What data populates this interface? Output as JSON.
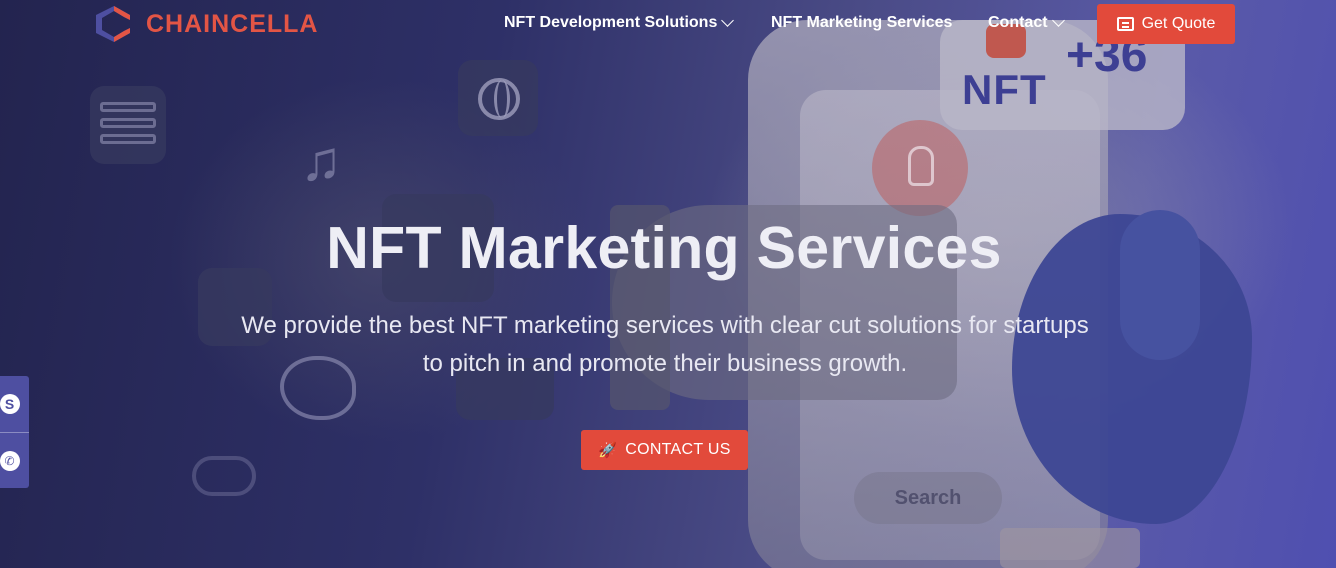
{
  "brand": {
    "name": "CHAINCELLA",
    "accent_color": "#e35545",
    "mark_color_primary": "#4e4fa1",
    "mark_color_secondary": "#e35545"
  },
  "nav": {
    "items": [
      {
        "label": "NFT Development Solutions",
        "has_dropdown": true
      },
      {
        "label": "NFT Marketing Services",
        "has_dropdown": false
      },
      {
        "label": "Contact",
        "has_dropdown": true
      }
    ],
    "cta_label": "Get Quote",
    "cta_icon": "message-icon",
    "cta_color": "#e24a3b"
  },
  "hero": {
    "title": "NFT Marketing Services",
    "subtitle": "We provide the best NFT marketing services with clear cut solutions for startups to pitch in and promote their business growth.",
    "button_label": "CONTACT US",
    "button_icon": "rocket-icon",
    "background_text": {
      "badge": "NFT",
      "counter": "+36",
      "search": "Search"
    }
  },
  "side_contact": {
    "items": [
      {
        "icon": "skype-icon",
        "glyph": "S"
      },
      {
        "icon": "phone-icon",
        "glyph": "✆"
      }
    ],
    "color": "#4e4fa1"
  }
}
